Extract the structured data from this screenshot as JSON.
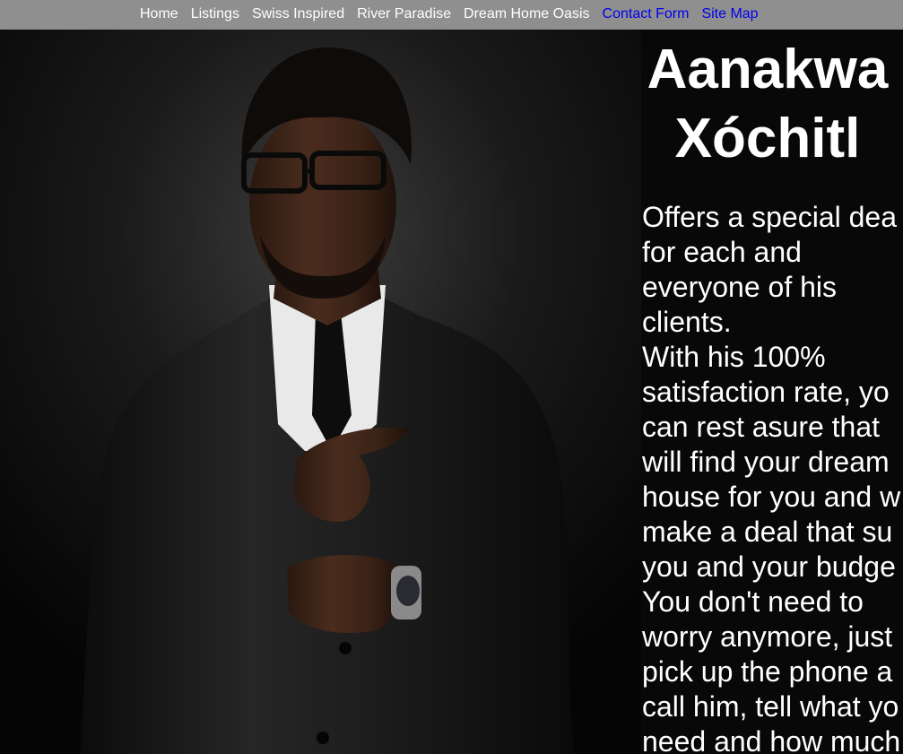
{
  "nav": {
    "items": [
      {
        "label": "Home",
        "color": "#ffffff"
      },
      {
        "label": "Listings",
        "color": "#ffffff"
      },
      {
        "label": "Swiss Inspired",
        "color": "#ffffff"
      },
      {
        "label": "River Paradise",
        "color": "#ffffff"
      },
      {
        "label": "Dream Home Oasis",
        "color": "#ffffff"
      },
      {
        "label": "Contact Form",
        "color": "#0000ee"
      },
      {
        "label": "Site Map",
        "color": "#0000ee"
      }
    ]
  },
  "agent": {
    "name_line1": "Aanakwa",
    "name_line2": "Xóchitl",
    "bio_lines": [
      "Offers a special dea",
      "for each and",
      "everyone of his",
      "clients.",
      "With his 100%",
      "satisfaction rate, yo",
      "can rest asure that",
      "will find your dream",
      "house for you and w",
      "make a deal that su",
      "you and your budge",
      "You don't need to",
      "worry anymore, just",
      "pick up the phone a",
      "call him, tell what yo",
      "need and how much"
    ]
  },
  "photo": {
    "subject": "agent-portrait-man-in-black-suit"
  }
}
